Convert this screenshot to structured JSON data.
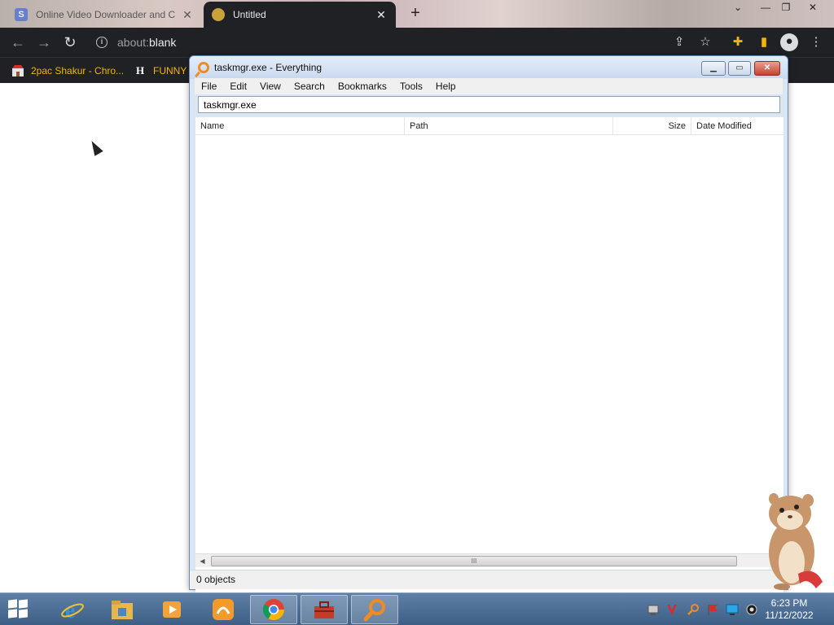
{
  "browser": {
    "tabs": [
      {
        "title": "Online Video Downloader and C",
        "favicon": "S",
        "active": false
      },
      {
        "title": "Untitled",
        "active": true
      }
    ],
    "address": {
      "scheme": "about:",
      "host": "blank"
    },
    "bookmarks": [
      {
        "label": "2pac Shakur - Chro...",
        "icon": "bookmark-app-icon"
      },
      {
        "label": "FUNNY",
        "icon": "H"
      }
    ]
  },
  "everything": {
    "title": "taskmgr.exe - Everything",
    "menu": [
      "File",
      "Edit",
      "View",
      "Search",
      "Bookmarks",
      "Tools",
      "Help"
    ],
    "search_value": "taskmgr.exe",
    "columns": [
      "Name",
      "Path",
      "Size",
      "Date Modified"
    ],
    "rows": [],
    "status": "0 objects",
    "scroll_grip": "III"
  },
  "taskbar": {
    "apps": [
      "internet-explorer-icon",
      "file-explorer-icon",
      "media-player-icon",
      "uc-browser-icon",
      "chrome-icon",
      "toolbox-icon",
      "everything-search-icon"
    ],
    "clock": {
      "time": "6:23 PM",
      "date": "11/12/2022"
    }
  },
  "colors": {
    "chrome_dark": "#202124",
    "bookmark_text": "#f5b400",
    "everything_accent": "#f08a24",
    "taskbar": "#4a6b92"
  }
}
